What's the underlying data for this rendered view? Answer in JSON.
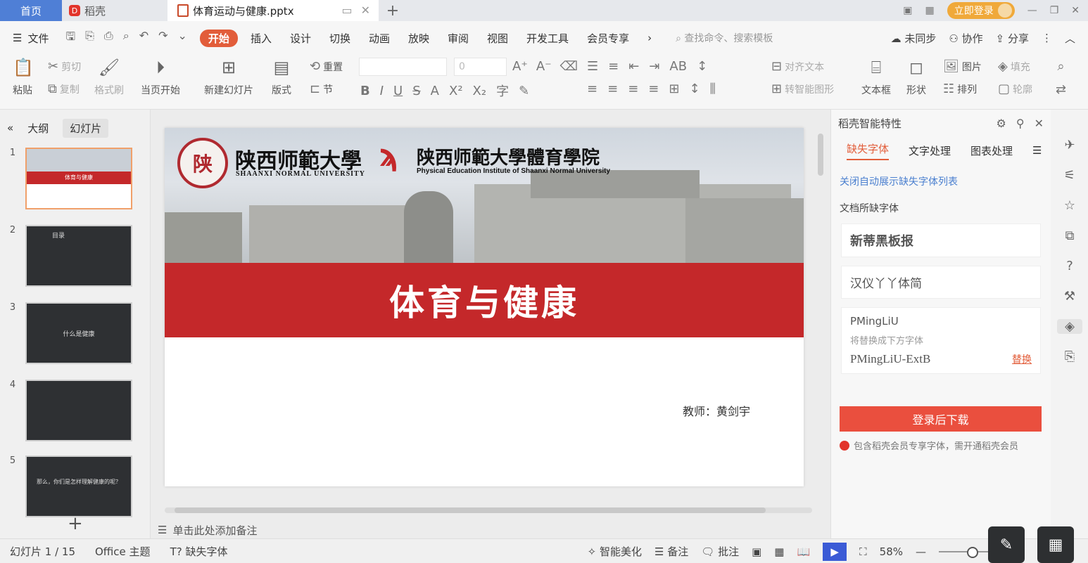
{
  "tabbar": {
    "home": "首页",
    "docer": "稻壳",
    "doc_title": "体育运动与健康.pptx",
    "login": "立即登录"
  },
  "menu": {
    "file": "文件",
    "items": [
      "开始",
      "插入",
      "设计",
      "切换",
      "动画",
      "放映",
      "审阅",
      "视图",
      "开发工具",
      "会员专享"
    ],
    "search_placeholder": "查找命令、搜索模板",
    "unsync": "未同步",
    "collab": "协作",
    "share": "分享"
  },
  "ribbon": {
    "paste": "粘贴",
    "cut": "剪切",
    "copy": "复制",
    "format_painter": "格式刷",
    "play_from_current": "当页开始",
    "new_slide": "新建幻灯片",
    "layout": "版式",
    "reset": "重置",
    "section": "节",
    "font_size": "0",
    "align_text": "对齐文本",
    "smartart": "转智能图形",
    "textbox": "文本框",
    "shape": "形状",
    "picture": "图片",
    "arrange": "排列",
    "fill": "填充",
    "outline": "轮廓"
  },
  "left_panel": {
    "tab_outline": "大纲",
    "tab_slides": "幻灯片",
    "slides": [
      {
        "num": "1",
        "label": "体育与健康"
      },
      {
        "num": "2",
        "label": "目录"
      },
      {
        "num": "3",
        "label": "什么是健康"
      },
      {
        "num": "4",
        "label": ""
      },
      {
        "num": "5",
        "label": "那么，你们是怎样理解健康的呢？"
      }
    ]
  },
  "slide": {
    "university_cn": "陕西师範大學",
    "university_en": "SHAANXI NORMAL UNIVERSITY",
    "seal_char": "陕",
    "institute_cn": "陕西师範大學體育學院",
    "institute_en": "Physical Education Institute of Shaanxi Normal University",
    "title": "体育与健康",
    "teacher": "教师：黄剑宇"
  },
  "notes_placeholder": "单击此处添加备注",
  "right_panel": {
    "header": "稻壳智能特性",
    "tabs": [
      "缺失字体",
      "文字处理",
      "图表处理"
    ],
    "close_auto_list": "关闭自动展示缺失字体列表",
    "missing_fonts_title": "文档所缺字体",
    "fonts": [
      "新蒂黑板报",
      "汉仪丫丫体简"
    ],
    "pmingliu": "PMingLiU",
    "replace_hint": "将替换成下方字体",
    "replace_font": "PMingLiU-ExtB",
    "replace_btn": "替换",
    "download_btn": "登录后下载",
    "download_note": "包含稻壳会员专享字体，需开通稻壳会员"
  },
  "status": {
    "slide_count": "幻灯片 1 / 15",
    "theme": "Office 主题",
    "missing_font": "缺失字体",
    "beautify": "智能美化",
    "notes": "备注",
    "comments": "批注",
    "zoom": "58%"
  },
  "colors": {
    "accent": "#e25d3a",
    "slide_band": "#c4282a",
    "home_tab": "#4f7fd6"
  }
}
